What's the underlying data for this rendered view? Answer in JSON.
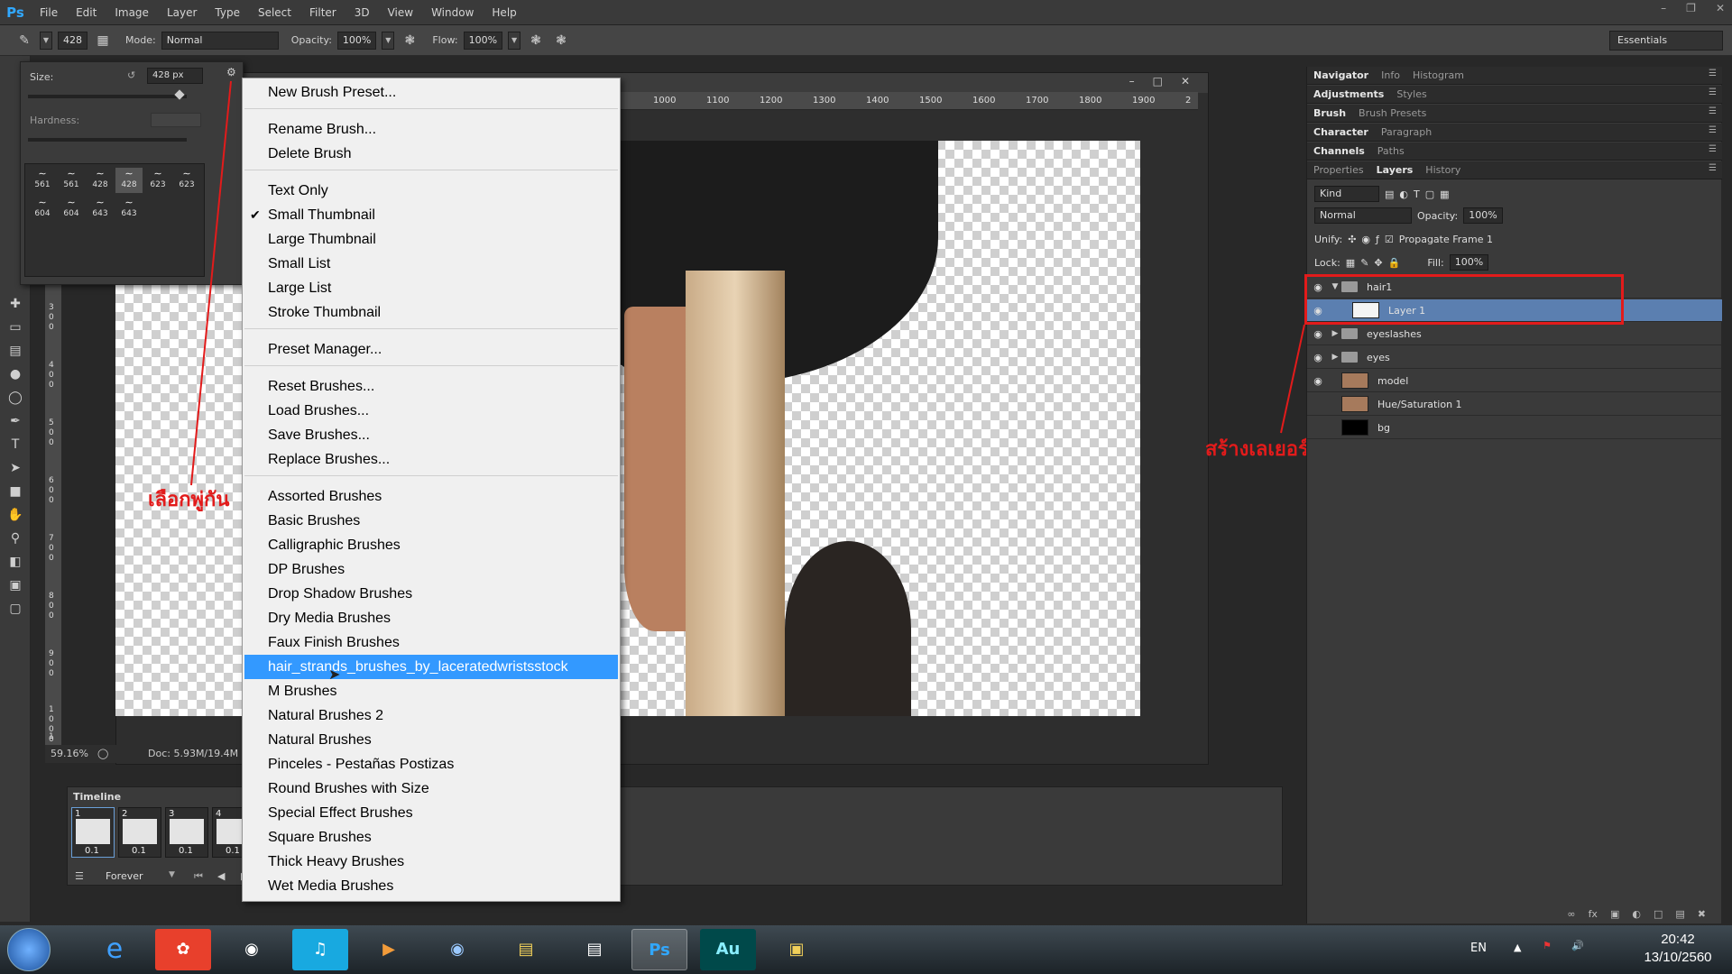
{
  "menubar": {
    "logo": "Ps",
    "items": [
      "File",
      "Edit",
      "Image",
      "Layer",
      "Type",
      "Select",
      "Filter",
      "3D",
      "View",
      "Window",
      "Help"
    ]
  },
  "options": {
    "size_value": "428",
    "mode_label": "Mode:",
    "mode_value": "Normal",
    "opacity_label": "Opacity:",
    "opacity_value": "100%",
    "flow_label": "Flow:",
    "flow_value": "100%",
    "workspace": "Essentials"
  },
  "brush_picker": {
    "size_label": "Size:",
    "size_value": "428 px",
    "hardness_label": "Hardness:",
    "thumbs": [
      "561",
      "561",
      "428",
      "428",
      "623",
      "623",
      "604",
      "604",
      "643",
      "643"
    ]
  },
  "context_menu": {
    "new_preset": "New Brush Preset...",
    "rename": "Rename Brush...",
    "delete": "Delete Brush",
    "text_only": "Text Only",
    "small_thumb": "Small Thumbnail",
    "large_thumb": "Large Thumbnail",
    "small_list": "Small List",
    "large_list": "Large List",
    "stroke_thumb": "Stroke Thumbnail",
    "preset_manager": "Preset Manager...",
    "reset": "Reset Brushes...",
    "load": "Load Brushes...",
    "save": "Save Brushes...",
    "replace": "Replace Brushes...",
    "libraries": [
      "Assorted Brushes",
      "Basic Brushes",
      "Calligraphic Brushes",
      "DP Brushes",
      "Drop Shadow Brushes",
      "Dry Media Brushes",
      "Faux Finish Brushes",
      "hair_strands_brushes_by_laceratedwristsstock",
      "M Brushes",
      "Natural Brushes 2",
      "Natural Brushes",
      "Pinceles - Pestañas Postizas",
      "Round Brushes with Size",
      "Special Effect Brushes",
      "Square Brushes",
      "Thick Heavy Brushes",
      "Wet Media Brushes"
    ]
  },
  "document": {
    "ruler_top": [
      "1000",
      "1100",
      "1200",
      "1300",
      "1400",
      "1500",
      "1600",
      "1700",
      "1800",
      "1900",
      "2"
    ],
    "ruler_left": [
      "300",
      "400",
      "500",
      "600",
      "700",
      "800",
      "900",
      "1000",
      "1"
    ],
    "zoom": "59.16%",
    "doc_info": "Doc: 5.93M/19.4M"
  },
  "annotations": {
    "left": "เลือกพู่กัน",
    "right": "สร้างเลเยอร์ใหม่"
  },
  "timeline": {
    "title": "Timeline",
    "frames": [
      {
        "num": "1",
        "dur": "0.1"
      },
      {
        "num": "2",
        "dur": "0.1"
      },
      {
        "num": "3",
        "dur": "0.1"
      },
      {
        "num": "4",
        "dur": "0.1"
      }
    ],
    "loop": "Forever"
  },
  "panels": {
    "row1": [
      "Navigator",
      "Info",
      "Histogram"
    ],
    "row2": [
      "Adjustments",
      "Styles"
    ],
    "row3": [
      "Brush",
      "Brush Presets"
    ],
    "row4": [
      "Character",
      "Paragraph"
    ],
    "row5": [
      "Channels",
      "Paths"
    ],
    "row6": [
      "Properties",
      "Layers",
      "History"
    ]
  },
  "layers_panel": {
    "kind": "Kind",
    "blend": "Normal",
    "opacity_label": "Opacity:",
    "opacity_value": "100%",
    "unify_label": "Unify:",
    "propagate": "Propagate Frame 1",
    "lock_label": "Lock:",
    "fill_label": "Fill:",
    "fill_value": "100%",
    "layers": [
      {
        "name": "hair1",
        "type": "group",
        "visible": true,
        "expanded": true
      },
      {
        "name": "Layer 1",
        "type": "layer",
        "visible": true,
        "selected": true
      },
      {
        "name": "eyeslashes",
        "type": "group",
        "visible": true
      },
      {
        "name": "eyes",
        "type": "group",
        "visible": true
      },
      {
        "name": "model",
        "type": "layer",
        "visible": true
      },
      {
        "name": "Hue/Saturation 1",
        "type": "layer",
        "visible": false
      },
      {
        "name": "bg",
        "type": "layer",
        "visible": false
      }
    ]
  },
  "taskbar": {
    "lang": "EN",
    "time": "20:42",
    "date": "13/10/2560"
  },
  "colors": {
    "menu_highlight": "#3399ff",
    "layer_selected": "#5b7fb0",
    "annotation": "#e21b1b",
    "ps_blue": "#31a8ff"
  }
}
